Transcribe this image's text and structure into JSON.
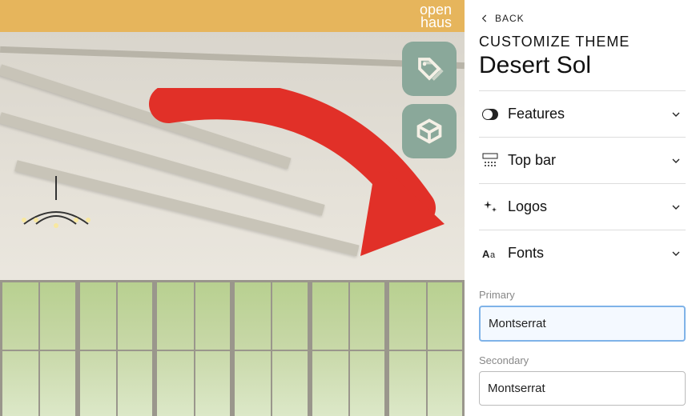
{
  "brand": {
    "line1": "open",
    "line2": "haus"
  },
  "panel": {
    "back_label": "BACK",
    "section_label": "CUSTOMIZE THEME",
    "theme_name": "Desert Sol",
    "groups": {
      "features": {
        "label": "Features"
      },
      "topbar": {
        "label": "Top bar"
      },
      "logos": {
        "label": "Logos"
      },
      "fonts": {
        "label": "Fonts"
      }
    },
    "fonts": {
      "primary_label": "Primary",
      "primary_value": "Montserrat",
      "secondary_label": "Secondary",
      "secondary_value": "Montserrat"
    }
  }
}
